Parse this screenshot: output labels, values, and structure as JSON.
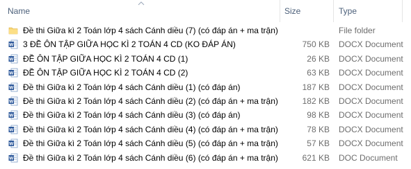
{
  "header": {
    "name_label": "Name",
    "size_label": "Size",
    "type_label": "Type",
    "sort_indicator": "chevron-up-icon"
  },
  "colors": {
    "header_text": "#4c607a",
    "secondary_text": "#6d6d6d",
    "folder": "#f8d775",
    "word_blue": "#2b579a"
  },
  "files": [
    {
      "name": "Đề thi Giữa kì 2 Toán lớp 4 sách Cánh diều (7) (có đáp án + ma trận)",
      "size": "",
      "type": "File folder",
      "icon": "folder-icon"
    },
    {
      "name": "3  ĐỀ ÔN TẬP GIỮA HỌC KÌ 2 TOÁN 4 CD (KO ĐÁP ÁN)",
      "size": "750 KB",
      "type": "DOCX Document",
      "icon": "word-document-icon"
    },
    {
      "name": "ĐỀ ÔN TẬP GIỮA HỌC KÌ 2 TOÁN 4 CD (1)",
      "size": "26 KB",
      "type": "DOCX Document",
      "icon": "word-document-icon"
    },
    {
      "name": "ĐỀ ÔN TẬP GIỮA HỌC KÌ 2 TOÁN 4 CD (2)",
      "size": "63 KB",
      "type": "DOCX Document",
      "icon": "word-document-icon"
    },
    {
      "name": "Đề thi Giữa kì 2 Toán lớp 4 sách Cánh diều (1) (có đáp án)",
      "size": "187 KB",
      "type": "DOCX Document",
      "icon": "word-document-icon"
    },
    {
      "name": "Đề thi Giữa kì 2 Toán lớp 4 sách Cánh diều (2) (có đáp án + ma trận)",
      "size": "182 KB",
      "type": "DOCX Document",
      "icon": "word-document-icon"
    },
    {
      "name": "Đề thi Giữa kì 2 Toán lớp 4 sách Cánh diều (3) (có đáp án)",
      "size": "98 KB",
      "type": "DOCX Document",
      "icon": "word-document-icon"
    },
    {
      "name": "Đề thi Giữa kì 2 Toán lớp 4 sách Cánh diều (4) (có đáp án + ma trận)",
      "size": "78 KB",
      "type": "DOCX Document",
      "icon": "word-document-icon"
    },
    {
      "name": "Đề thi Giữa kì 2 Toán lớp 4 sách Cánh diều (5) (có đáp án + ma trận)",
      "size": "57 KB",
      "type": "DOCX Document",
      "icon": "word-document-icon"
    },
    {
      "name": "Đề thi Giữa kì 2 Toán lớp 4 sách Cánh diều (6) (có đáp án + ma trận)",
      "size": "621 KB",
      "type": "DOC Document",
      "icon": "word-document-icon"
    }
  ]
}
